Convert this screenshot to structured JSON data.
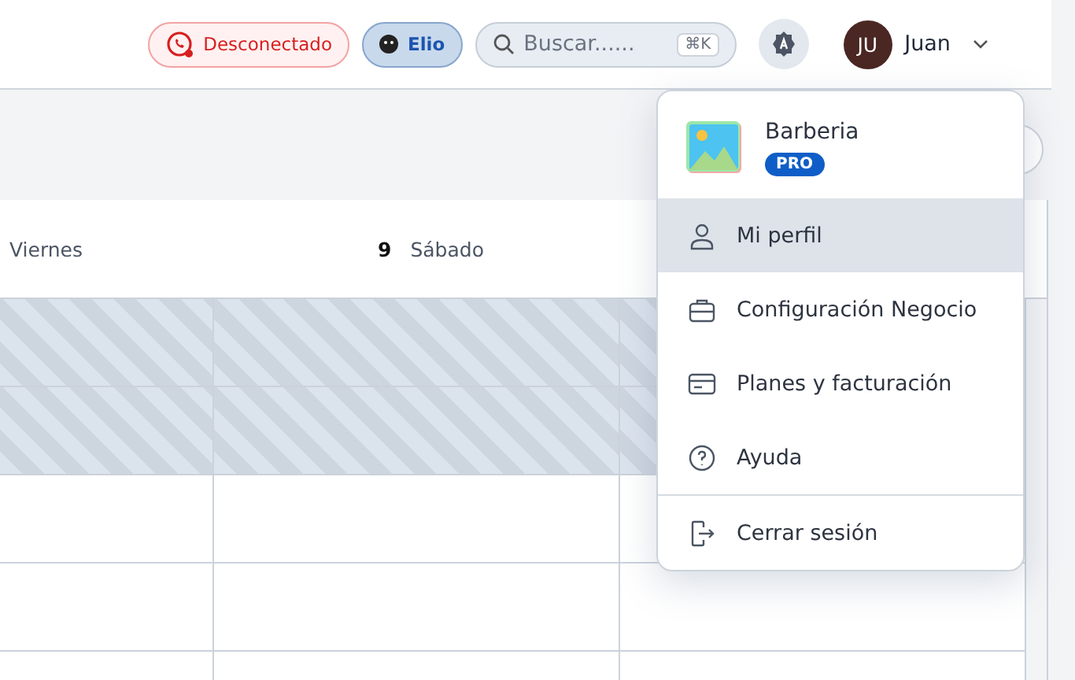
{
  "header": {
    "status": {
      "label": "Desconectado"
    },
    "assistant": {
      "label": "Elio"
    },
    "search": {
      "placeholder": "Buscar......",
      "shortcut": "⌘K"
    },
    "user": {
      "initials": "JU",
      "name": "Juan"
    }
  },
  "calendar": {
    "days": [
      {
        "label": "Viernes"
      },
      {
        "number": "9",
        "label": "Sábado"
      }
    ],
    "rows": [
      {
        "blocked": true
      },
      {
        "blocked": true
      },
      {
        "blocked": false
      },
      {
        "blocked": false
      },
      {
        "blocked": false
      }
    ]
  },
  "menu": {
    "business": "Barberia",
    "badge": "PRO",
    "items": [
      {
        "kind": "profile",
        "label": "Mi perfil",
        "selected": true
      },
      {
        "kind": "business",
        "label": "Configuración Negocio",
        "selected": false
      },
      {
        "kind": "billing",
        "label": "Planes y facturación",
        "selected": false
      },
      {
        "kind": "help",
        "label": "Ayuda",
        "selected": false
      },
      {
        "kind": "logout",
        "label": "Cerrar sesión",
        "selected": false
      }
    ]
  }
}
